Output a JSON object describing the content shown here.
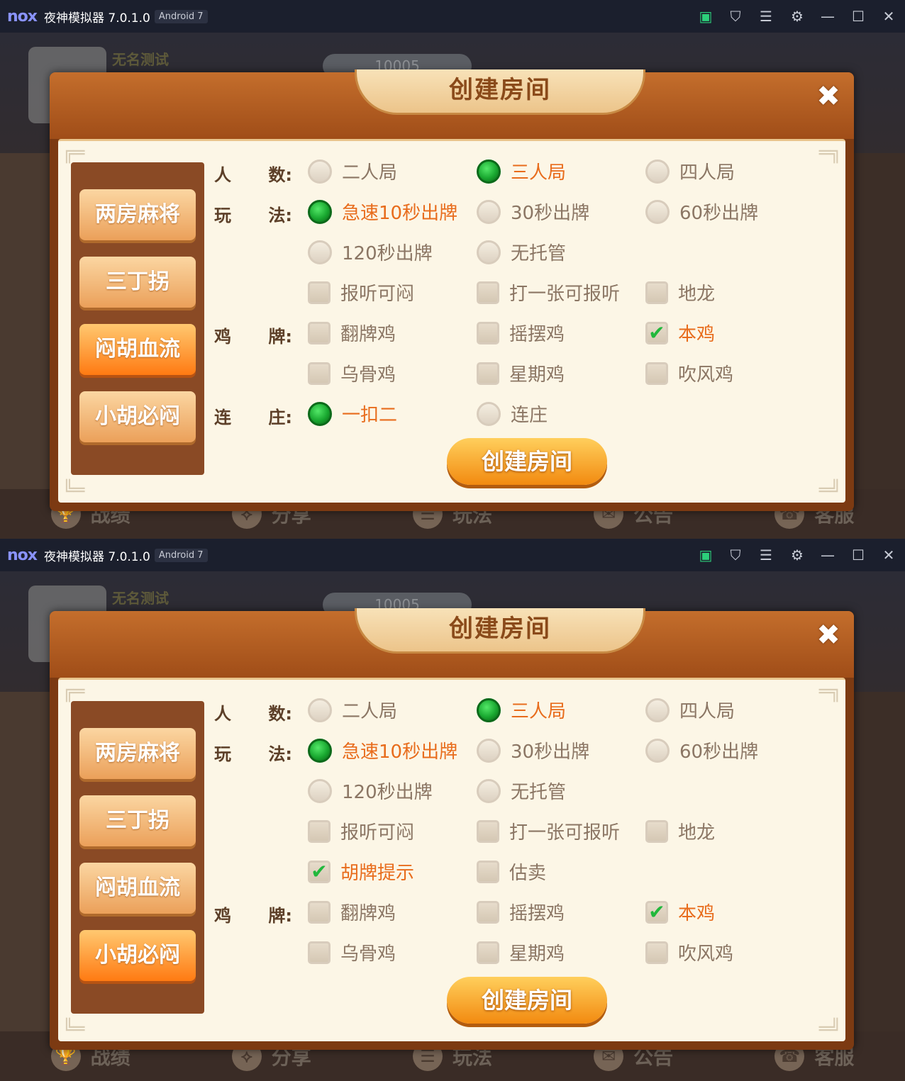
{
  "emulator": {
    "logo": "nox",
    "title": "夜神模拟器 7.0.1.0",
    "android": "Android 7"
  },
  "window_controls": [
    "app-icon",
    "shirt-icon",
    "menu-icon",
    "gear-icon",
    "minimize-icon",
    "maximize-icon",
    "close-icon"
  ],
  "background": {
    "username": "无名测试",
    "coins": "10005"
  },
  "bottom_nav": [
    "战绩",
    "分享",
    "玩法",
    "公告",
    "客服"
  ],
  "dialog": {
    "title": "创建房间",
    "create_button": "创建房间",
    "tabs": [
      "两房麻将",
      "三丁拐",
      "闷胡血流",
      "小胡必闷"
    ]
  },
  "shot1": {
    "active_tab": "闷胡血流",
    "rows": [
      {
        "label": [
          "人",
          "数:"
        ],
        "options": [
          {
            "type": "radio",
            "text": "二人局",
            "checked": false
          },
          {
            "type": "radio",
            "text": "三人局",
            "checked": true
          },
          {
            "type": "radio",
            "text": "四人局",
            "checked": false
          }
        ]
      },
      {
        "label": [
          "玩",
          "法:"
        ],
        "options": [
          {
            "type": "radio",
            "text": "急速10秒出牌",
            "checked": true
          },
          {
            "type": "radio",
            "text": "30秒出牌",
            "checked": false
          },
          {
            "type": "radio",
            "text": "60秒出牌",
            "checked": false
          }
        ]
      },
      {
        "label": null,
        "options": [
          {
            "type": "radio",
            "text": "120秒出牌",
            "checked": false
          },
          {
            "type": "radio",
            "text": "无托管",
            "checked": false
          }
        ]
      },
      {
        "label": null,
        "options": [
          {
            "type": "check",
            "text": "报听可闷",
            "checked": false
          },
          {
            "type": "check",
            "text": "打一张可报听",
            "checked": false
          },
          {
            "type": "check",
            "text": "地龙",
            "checked": false
          }
        ]
      },
      {
        "label": [
          "鸡",
          "牌:"
        ],
        "options": [
          {
            "type": "check",
            "text": "翻牌鸡",
            "checked": false
          },
          {
            "type": "check",
            "text": "摇摆鸡",
            "checked": false
          },
          {
            "type": "check",
            "text": "本鸡",
            "checked": true
          }
        ]
      },
      {
        "label": null,
        "options": [
          {
            "type": "check",
            "text": "乌骨鸡",
            "checked": false
          },
          {
            "type": "check",
            "text": "星期鸡",
            "checked": false
          },
          {
            "type": "check",
            "text": "吹风鸡",
            "checked": false
          }
        ]
      },
      {
        "label": [
          "连",
          "庄:"
        ],
        "options": [
          {
            "type": "radio",
            "text": "一扣二",
            "checked": true
          },
          {
            "type": "radio",
            "text": "连庄",
            "checked": false
          }
        ]
      }
    ]
  },
  "shot2": {
    "active_tab": "小胡必闷",
    "rows": [
      {
        "label": [
          "人",
          "数:"
        ],
        "options": [
          {
            "type": "radio",
            "text": "二人局",
            "checked": false
          },
          {
            "type": "radio",
            "text": "三人局",
            "checked": true
          },
          {
            "type": "radio",
            "text": "四人局",
            "checked": false
          }
        ]
      },
      {
        "label": [
          "玩",
          "法:"
        ],
        "options": [
          {
            "type": "radio",
            "text": "急速10秒出牌",
            "checked": true
          },
          {
            "type": "radio",
            "text": "30秒出牌",
            "checked": false
          },
          {
            "type": "radio",
            "text": "60秒出牌",
            "checked": false
          }
        ]
      },
      {
        "label": null,
        "options": [
          {
            "type": "radio",
            "text": "120秒出牌",
            "checked": false
          },
          {
            "type": "radio",
            "text": "无托管",
            "checked": false
          }
        ]
      },
      {
        "label": null,
        "options": [
          {
            "type": "check",
            "text": "报听可闷",
            "checked": false
          },
          {
            "type": "check",
            "text": "打一张可报听",
            "checked": false
          },
          {
            "type": "check",
            "text": "地龙",
            "checked": false
          }
        ]
      },
      {
        "label": null,
        "options": [
          {
            "type": "check",
            "text": "胡牌提示",
            "checked": true
          },
          {
            "type": "check",
            "text": "估卖",
            "checked": false
          }
        ]
      },
      {
        "label": [
          "鸡",
          "牌:"
        ],
        "options": [
          {
            "type": "check",
            "text": "翻牌鸡",
            "checked": false
          },
          {
            "type": "check",
            "text": "摇摆鸡",
            "checked": false
          },
          {
            "type": "check",
            "text": "本鸡",
            "checked": true
          }
        ]
      },
      {
        "label": null,
        "options": [
          {
            "type": "check",
            "text": "乌骨鸡",
            "checked": false
          },
          {
            "type": "check",
            "text": "星期鸡",
            "checked": false
          },
          {
            "type": "check",
            "text": "吹风鸡",
            "checked": false
          }
        ]
      }
    ]
  }
}
